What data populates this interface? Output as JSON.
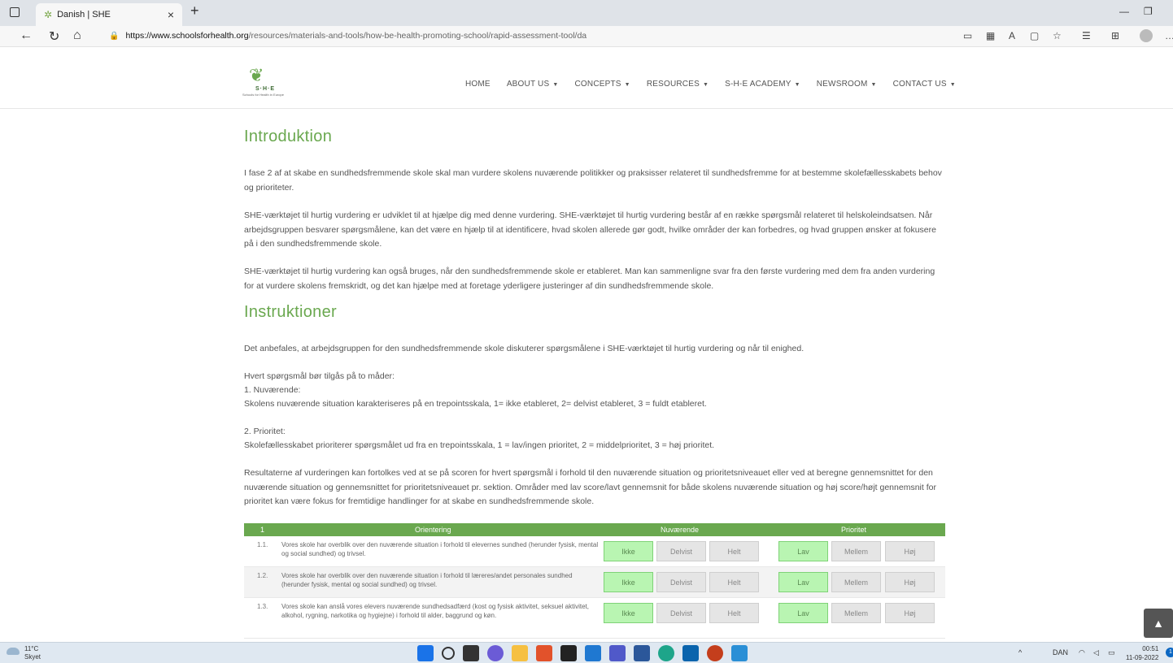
{
  "browser": {
    "tab_title": "Danish | SHE",
    "tab_close": "×",
    "new_tab": "+",
    "url_host": "https://www.schoolsforhealth.org",
    "url_path": "/resources/materials-and-tools/how-be-health-promoting-school/rapid-assessment-tool/da"
  },
  "site": {
    "logo_text": "S·H·E",
    "logo_sub": "Schools for Health in Europe",
    "nav": [
      {
        "label": "HOME",
        "caret": ""
      },
      {
        "label": "ABOUT US",
        "caret": "▼"
      },
      {
        "label": "CONCEPTS",
        "caret": "▼"
      },
      {
        "label": "RESOURCES",
        "caret": "▼"
      },
      {
        "label": "S-H-E ACADEMY",
        "caret": "▼"
      },
      {
        "label": "NEWSROOM",
        "caret": "▼"
      },
      {
        "label": "CONTACT US",
        "caret": "▼"
      }
    ]
  },
  "intro": {
    "heading": "Introduktion",
    "p1": "I fase 2 af at skabe en sundhedsfremmende skole skal man vurdere skolens nuværende politikker og praksisser relateret til sundhedsfremme for at bestemme skolefællesskabets behov og prioriteter.",
    "p2": "SHE-værktøjet til hurtig vurdering er udviklet til at hjælpe dig med denne vurdering. SHE-værktøjet til hurtig vurdering består af en række spørgsmål relateret til helskoleindsatsen. Når arbejdsgruppen besvarer spørgsmålene, kan det være en hjælp til at identificere, hvad skolen allerede gør godt, hvilke områder der kan forbedres, og hvad gruppen ønsker at fokusere på i den sundhedsfremmende skole.",
    "p3": "SHE-værktøjet til hurtig vurdering kan også bruges, når den sundhedsfremmende skole er etableret. Man kan sammenligne svar fra den første vurdering med dem fra anden vurdering for at vurdere skolens fremskridt, og det kan hjælpe med at foretage yderligere justeringer af din sundhedsfremmende skole."
  },
  "instructions": {
    "heading": "Instruktioner",
    "p1": "Det anbefales, at arbejdsgruppen for den sundhedsfremmende skole diskuterer spørgsmålene i SHE-værktøjet til hurtig vurdering og når til enighed.",
    "l1": "Hvert spørgsmål bør tilgås på to måder:",
    "l2": "1. Nuværende:",
    "l3": "Skolens nuværende situation karakteriseres på en trepointsskala, 1= ikke etableret, 2= delvist etableret, 3 = fuldt etableret.",
    "l4": "2. Prioritet:",
    "l5": "Skolefællesskabet prioriterer spørgsmålet ud fra en trepointsskala, 1 = lav/ingen prioritet, 2 = middelprioritet, 3 = høj prioritet.",
    "p2": "Resultaterne af vurderingen kan fortolkes ved at se på scoren for hvert spørgsmål i forhold til den nuværende situation og prioritetsniveauet eller ved at beregne gennemsnittet for den nuværende situation og gennemsnittet for prioritetsniveauet pr. sektion. Områder med lav score/lavt gennemsnit for både skolens nuværende situation og høj score/højt gennemsnit for prioritet kan være fokus for fremtidige handlinger for at skabe en sundhedsfremmende skole."
  },
  "table": {
    "section_no": "1",
    "section_title": "Orientering",
    "col_current": "Nuværende",
    "col_priority": "Prioritet",
    "current_opts": [
      "Ikke",
      "Delvist",
      "Helt"
    ],
    "priority_opts": [
      "Lav",
      "Mellem",
      "Høj"
    ],
    "rows": [
      {
        "no": "1.1.",
        "text": "Vores skole har overblik over den nuværende situation i forhold til elevernes sundhed (herunder fysisk, mental og social sundhed) og trivsel."
      },
      {
        "no": "1.2.",
        "text": "Vores skole har overblik over den nuværende situation i forhold til læreres/andet personales sundhed (herunder fysisk, mental og social sundhed) og trivsel."
      },
      {
        "no": "1.3.",
        "text": "Vores skole kan anslå vores elevers nuværende sundhedsadfærd (kost og fysisk aktivitet, seksuel aktivitet, alkohol, rygning, narkotika og hygiejne) i forhold til alder, baggrund og køn."
      }
    ]
  },
  "taskbar": {
    "temp": "11°C",
    "weather": "Skyet",
    "lang": "DAN",
    "time": "00:51",
    "date": "11-09-2022",
    "notif": "1"
  },
  "colors": {
    "brand_green": "#6aa84f",
    "selected_green": "#b9f5b2"
  }
}
